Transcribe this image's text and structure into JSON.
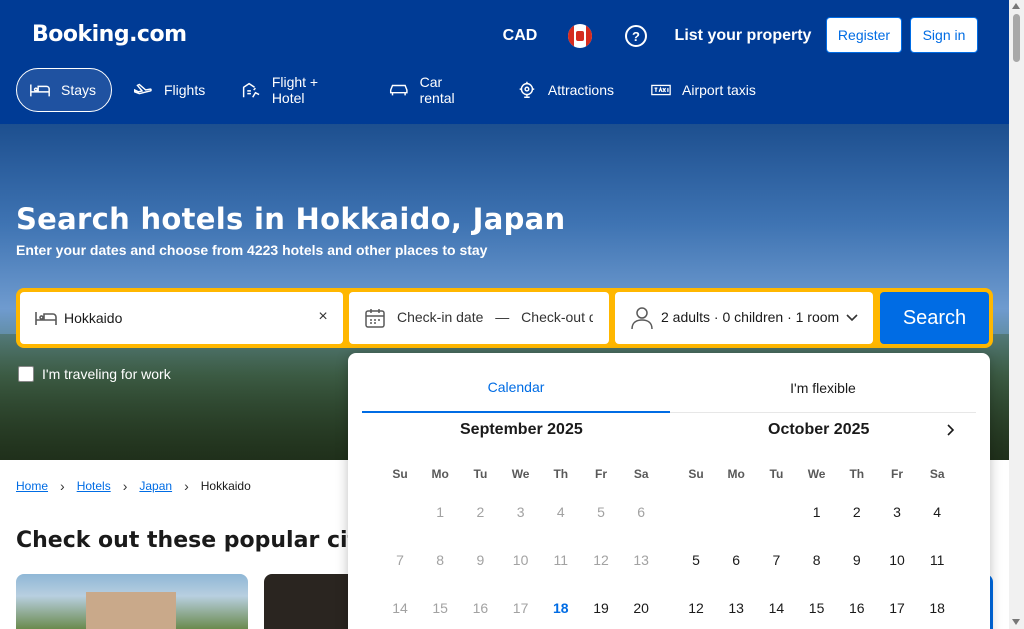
{
  "header": {
    "logo": "Booking.com",
    "currency": "CAD",
    "help_icon": "?",
    "list_property": "List your property",
    "register": "Register",
    "sign_in": "Sign in"
  },
  "nav": {
    "tabs": [
      {
        "label": "Stays",
        "icon": "bed-icon"
      },
      {
        "label": "Flights",
        "icon": "plane-icon"
      },
      {
        "label": "Flight + Hotel",
        "icon": "flight-hotel-icon"
      },
      {
        "label": "Car rental",
        "icon": "car-icon"
      },
      {
        "label": "Attractions",
        "icon": "attractions-icon"
      },
      {
        "label": "Airport taxis",
        "icon": "taxi-icon"
      }
    ]
  },
  "hero": {
    "title": "Search hotels in Hokkaido, Japan",
    "subtitle": "Enter your dates and choose from 4223 hotels and other places to stay"
  },
  "search": {
    "destination": "Hokkaido",
    "clear": "×",
    "checkin": "Check-in date",
    "dash": "—",
    "checkout": "Check-out da",
    "occupancy": "2 adults · 0 children · 1 room",
    "button": "Search",
    "work_label": "I'm traveling for work"
  },
  "breadcrumb": [
    "Home",
    "Hotels",
    "Japan",
    "Hokkaido"
  ],
  "popular_title": "Check out these popular citi",
  "picker": {
    "tab_calendar": "Calendar",
    "tab_flexible": "I'm flexible",
    "month1": "September 2025",
    "month2": "October 2025",
    "weekdays1": [
      "Su",
      "Mo",
      "Tu",
      "We",
      "Th",
      "Fr",
      "Sa"
    ],
    "weekdays2": [
      "Su",
      "Mo",
      "Tu",
      "We",
      "Th",
      "Fr",
      "Sa"
    ],
    "m1_row1": [
      "",
      "1",
      "2",
      "3",
      "4",
      "5",
      "6"
    ],
    "m1_row2": [
      "7",
      "8",
      "9",
      "10",
      "11",
      "12",
      "13"
    ],
    "m1_row3": [
      "14",
      "15",
      "16",
      "17",
      "18",
      "19",
      "20"
    ],
    "m2_row1": [
      "",
      "",
      "",
      "1",
      "2",
      "3",
      "4"
    ],
    "m2_row2": [
      "5",
      "6",
      "7",
      "8",
      "9",
      "10",
      "11"
    ],
    "m2_row3": [
      "12",
      "13",
      "14",
      "15",
      "16",
      "17",
      "18"
    ],
    "today": "18"
  },
  "colors": {
    "brand": "#003b95",
    "accent": "#006ce4",
    "searchbar": "#ffb700"
  }
}
